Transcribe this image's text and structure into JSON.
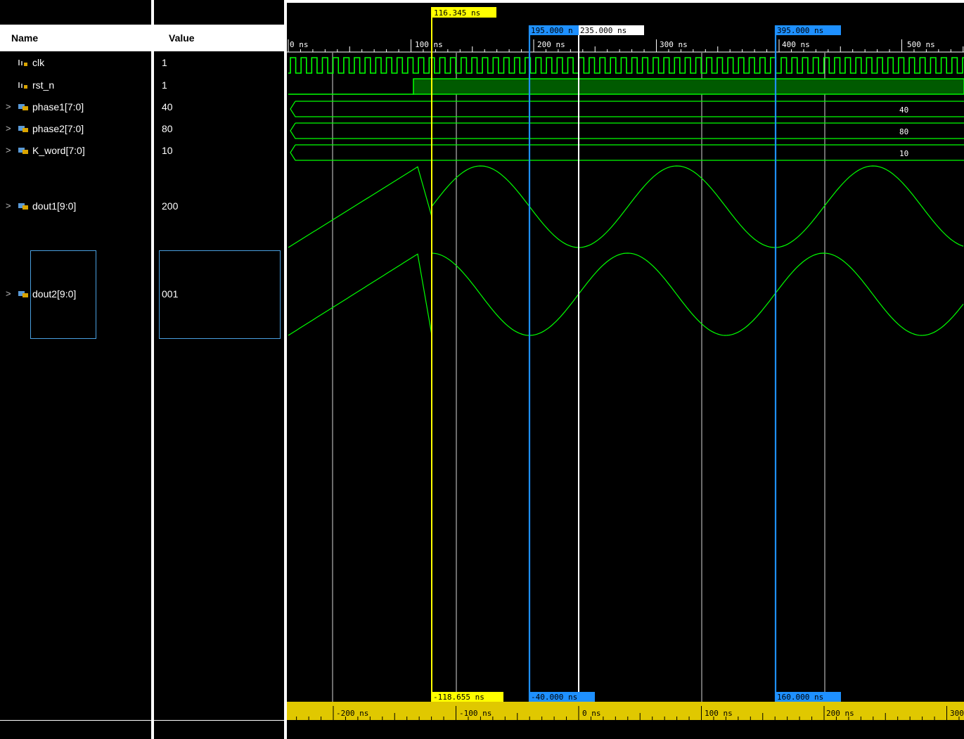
{
  "header": {
    "name_label": "Name",
    "value_label": "Value"
  },
  "signals": [
    {
      "name": "clk",
      "value": "1",
      "kind": "bit"
    },
    {
      "name": "rst_n",
      "value": "1",
      "kind": "bit"
    },
    {
      "name": "phase1[7:0]",
      "value": "40",
      "kind": "bus",
      "wave_label": "40"
    },
    {
      "name": "phase2[7:0]",
      "value": "80",
      "kind": "bus",
      "wave_label": "80"
    },
    {
      "name": "K_word[7:0]",
      "value": "10",
      "kind": "bus",
      "wave_label": "10"
    },
    {
      "name": "dout1[9:0]",
      "value": "200",
      "kind": "analog"
    },
    {
      "name": "dout2[9:0]",
      "value": "001",
      "kind": "analog"
    }
  ],
  "timeline": {
    "ticks": [
      "0 ns",
      "100 ns",
      "200 ns",
      "300 ns",
      "400 ns",
      "500 ns"
    ],
    "relative_ticks": [
      "-200 ns",
      "-100 ns",
      "0 ns",
      "100 ns",
      "200 ns",
      "300"
    ]
  },
  "markers": {
    "cursor": "116.345 ns",
    "marker1": "195.000 n",
    "marker_white": "235.000 ns",
    "marker2": "395.000 ns",
    "rel_cursor": "-118.655 ns",
    "rel_marker1": "-40.000 ns",
    "rel_marker2": "160.000 ns"
  },
  "colors": {
    "wave": "#00ff00",
    "bus_fill": "#005a00",
    "cursor": "#ffff00",
    "marker": "#1e90ff",
    "relative_bar": "#e0c800"
  }
}
